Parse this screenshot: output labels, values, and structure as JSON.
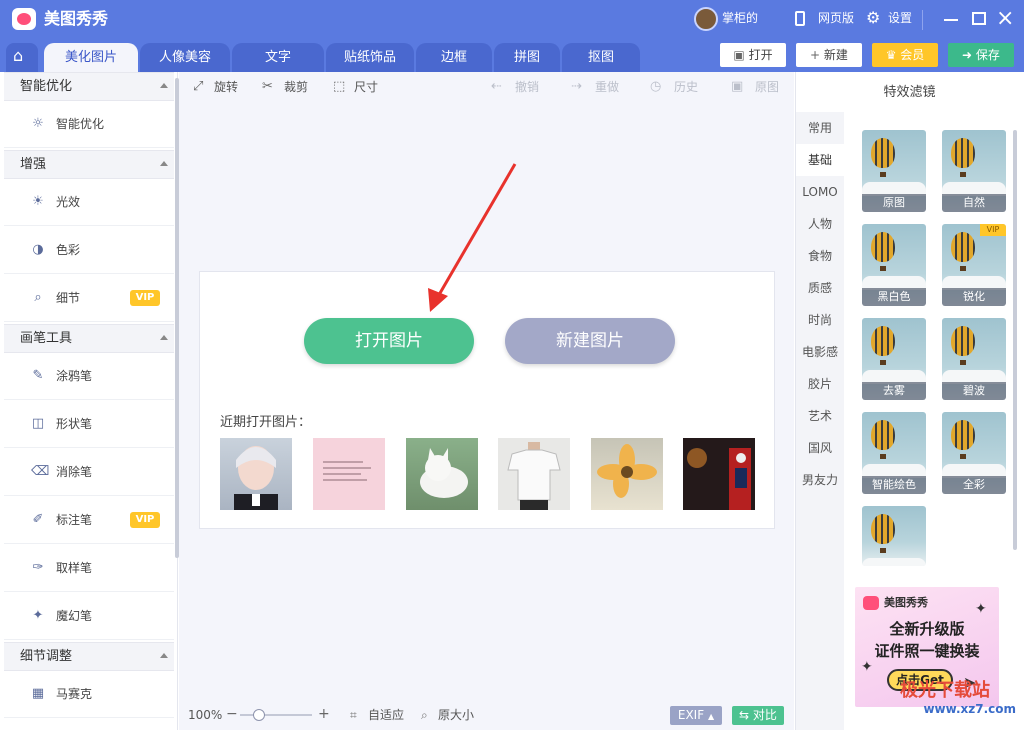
{
  "app": {
    "name": "美图秀秀"
  },
  "titlebar": {
    "username": "掌柜的",
    "web_label": "网页版",
    "settings_label": "设置"
  },
  "tabs": [
    "美化图片",
    "人像美容",
    "文字",
    "贴纸饰品",
    "边框",
    "拼图",
    "抠图"
  ],
  "active_tab": "美化图片",
  "actions": {
    "open": "打开",
    "new": "新建",
    "vip": "会员",
    "save": "保存"
  },
  "left": {
    "sections": [
      {
        "title": "智能优化",
        "items": [
          {
            "label": "智能优化",
            "icon": "bulb-icon"
          }
        ]
      },
      {
        "title": "增强",
        "items": [
          {
            "label": "光效",
            "icon": "sun-icon"
          },
          {
            "label": "色彩",
            "icon": "palette-icon"
          },
          {
            "label": "细节",
            "icon": "magnify-icon",
            "badge": "VIP"
          }
        ]
      },
      {
        "title": "画笔工具",
        "items": [
          {
            "label": "涂鸦笔",
            "icon": "pen-icon"
          },
          {
            "label": "形状笔",
            "icon": "shape-icon"
          },
          {
            "label": "消除笔",
            "icon": "eraser-icon"
          },
          {
            "label": "标注笔",
            "icon": "marker-icon",
            "badge": "VIP"
          },
          {
            "label": "取样笔",
            "icon": "dropper-icon"
          },
          {
            "label": "魔幻笔",
            "icon": "wand-icon"
          }
        ]
      },
      {
        "title": "细节调整",
        "items": [
          {
            "label": "马赛克",
            "icon": "mosaic-icon"
          }
        ]
      }
    ]
  },
  "toolbar": {
    "rotate": "旋转",
    "crop": "裁剪",
    "size": "尺寸",
    "undo": "撤销",
    "redo": "重做",
    "history": "历史",
    "original": "原图"
  },
  "main": {
    "open_image": "打开图片",
    "new_image": "新建图片",
    "recent_title": "近期打开图片："
  },
  "bottom": {
    "zoom": "100%",
    "fit": "自适应",
    "actual": "原大小",
    "exif": "EXIF",
    "compare": "对比",
    "zoom_level": 0.2
  },
  "right": {
    "title": "特效滤镜",
    "categories": [
      "常用",
      "基础",
      "LOMO",
      "人物",
      "食物",
      "质感",
      "时尚",
      "电影感",
      "胶片",
      "艺术",
      "国风",
      "男友力"
    ],
    "active_category": "基础",
    "filters": [
      {
        "label": "原图"
      },
      {
        "label": "自然"
      },
      {
        "label": "黑白色"
      },
      {
        "label": "锐化",
        "badge": "VIP"
      },
      {
        "label": "去雾"
      },
      {
        "label": "碧波"
      },
      {
        "label": "智能绘色"
      },
      {
        "label": "全彩"
      },
      {
        "label": ""
      }
    ],
    "ad": {
      "brand": "美图秀秀",
      "line1": "全新升级版",
      "line2": "证件照一键换装",
      "cta": "点击Get"
    }
  },
  "watermark": {
    "text": "极光下载站",
    "url": "www.xz7.com"
  }
}
